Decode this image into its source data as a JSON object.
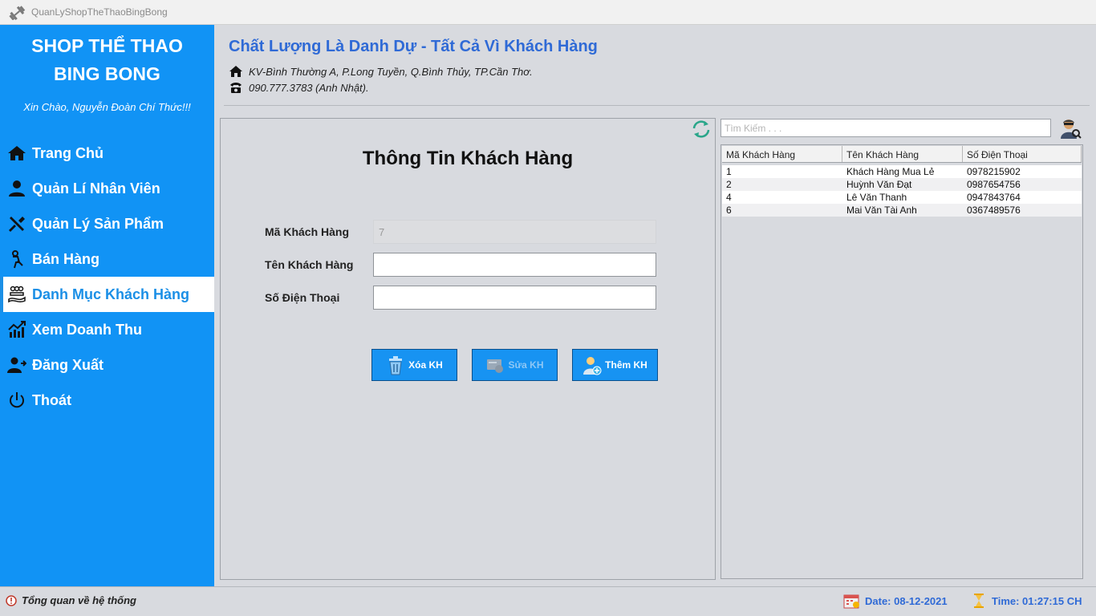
{
  "window": {
    "title": "QuanLyShopTheThaoBingBong"
  },
  "sidebar": {
    "brand_line1": "SHOP THỂ THAO",
    "brand_line2": "BING BONG",
    "greeting": "Xin Chào, Nguyễn Đoàn Chí Thức!!!",
    "items": [
      {
        "label": "Trang Chủ",
        "icon": "home-icon"
      },
      {
        "label": "Quản Lí Nhân Viên",
        "icon": "user-icon"
      },
      {
        "label": "Quản Lý Sản Phẩm",
        "icon": "tools-icon"
      },
      {
        "label": "Bán Hàng",
        "icon": "sell-icon"
      },
      {
        "label": "Danh Mục Khách Hàng",
        "icon": "customers-icon",
        "active": true
      },
      {
        "label": "Xem Doanh Thu",
        "icon": "revenue-chart-icon"
      },
      {
        "label": "Đăng Xuất",
        "icon": "logout-icon"
      },
      {
        "label": "Thoát",
        "icon": "power-icon"
      }
    ]
  },
  "header": {
    "slogan": "Chất Lượng Là Danh Dự - Tất Cả Vì Khách Hàng",
    "address": "KV-Bình Thường A, P.Long Tuyền, Q.Bình Thủy, TP.Cần Thơ.",
    "phone": "090.777.3783 (Anh Nhật)."
  },
  "form": {
    "title": "Thông Tin Khách Hàng",
    "id_label": "Mã Khách Hàng",
    "id_value": "7",
    "name_label": "Tên Khách Hàng",
    "name_value": "",
    "phone_label": "Số Điện Thoại",
    "phone_value": "",
    "delete_label": "Xóa KH",
    "edit_label": "Sửa KH",
    "add_label": "Thêm KH"
  },
  "search": {
    "placeholder": "Tìm Kiếm . . ."
  },
  "table": {
    "columns": [
      "Mã Khách Hàng",
      "Tên Khách Hàng",
      "Số Điện Thoại"
    ],
    "rows": [
      [
        "1",
        "Khách Hàng Mua Lẻ",
        "0978215902"
      ],
      [
        "2",
        "Huỳnh Văn Đạt",
        "0987654756"
      ],
      [
        "4",
        "Lê Văn Thanh",
        "0947843764"
      ],
      [
        "6",
        "Mai Văn Tài Anh",
        "0367489576"
      ]
    ]
  },
  "status": {
    "overview": "Tổng quan về hệ thống",
    "date": "Date: 08-12-2021",
    "time": "Time: 01:27:15 CH"
  },
  "colors": {
    "sidebar": "#1193f5",
    "accent": "#2f6ad6",
    "button": "#1793f2",
    "background": "#d8dadf"
  }
}
